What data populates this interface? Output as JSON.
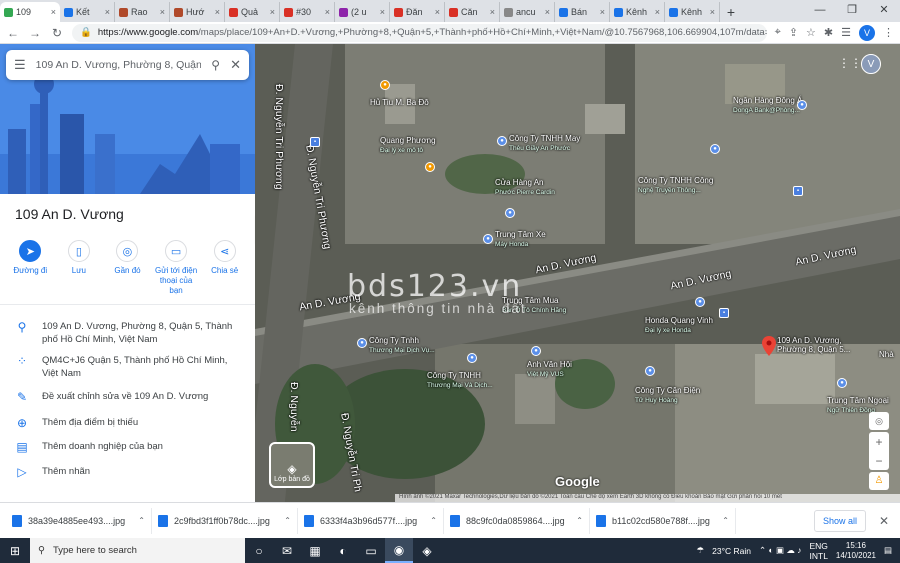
{
  "browser": {
    "tabs": [
      {
        "label": "109",
        "icon": "maps-pin-icon",
        "color": "#34a853",
        "active": true
      },
      {
        "label": "Kết",
        "icon": "image-icon",
        "color": "#1a73e8"
      },
      {
        "label": "Rao",
        "icon": "house-icon",
        "color": "#b0492a"
      },
      {
        "label": "Hướ",
        "icon": "house-icon",
        "color": "#b0492a"
      },
      {
        "label": "Quả",
        "icon": "grid-icon",
        "color": "#d93025"
      },
      {
        "label": "#30",
        "icon": "home-icon",
        "color": "#d93025"
      },
      {
        "label": "(2 u",
        "icon": "mail-icon",
        "color": "#8e24aa"
      },
      {
        "label": "Đăn",
        "icon": "house-icon",
        "color": "#d93025"
      },
      {
        "label": "Căn",
        "icon": "home-icon",
        "color": "#d93025"
      },
      {
        "label": "ancu",
        "icon": "house-icon",
        "color": "#888888"
      },
      {
        "label": "Bán",
        "icon": "house-icon",
        "color": "#1a73e8"
      },
      {
        "label": "Kênh",
        "icon": "house-icon",
        "color": "#1a73e8"
      },
      {
        "label": "Kênh",
        "icon": "house-icon",
        "color": "#1a73e8"
      }
    ],
    "new_tab": "+",
    "url_domain": "https://www.google.com",
    "url_rest": "/maps/place/109+An+D.+Vương,+Phường+8,+Quận+5,+Thành+phố+Hồ+Chí+Minh,+Việt+Nam/@10.7567968,106.669904,107m/data=!3m1!1e3!4m13!1...",
    "profile_letter": "V"
  },
  "panel": {
    "search_value": "109 An D. Vương, Phường 8, Quận",
    "place_title": "109 An D. Vương",
    "actions": [
      {
        "label": "Đường đi",
        "icon": "directions-icon"
      },
      {
        "label": "Lưu",
        "icon": "bookmark-icon"
      },
      {
        "label": "Gần đó",
        "icon": "nearby-icon"
      },
      {
        "label": "Gửi tới điện thoại của bạn",
        "icon": "send-to-phone-icon"
      },
      {
        "label": "Chia sẻ",
        "icon": "share-icon"
      }
    ],
    "info": [
      {
        "icon": "location-pin-icon",
        "text": "109 An D. Vương, Phường 8, Quận 5, Thành phố Hồ Chí Minh, Việt Nam"
      },
      {
        "icon": "plus-code-icon",
        "text": "QM4C+J6 Quận 5, Thành phố Hồ Chí Minh, Việt Nam"
      },
      {
        "icon": "pencil-icon",
        "text": "Đề xuất chỉnh sửa về 109 An D. Vương"
      },
      {
        "icon": "add-place-icon",
        "text": "Thêm địa điểm bị thiếu"
      },
      {
        "icon": "add-business-icon",
        "text": "Thêm doanh nghiệp của bạn"
      },
      {
        "icon": "label-icon",
        "text": "Thêm nhãn"
      }
    ]
  },
  "map": {
    "streets": [
      "An D. Vương",
      "An D. Vương",
      "An D. Vương",
      "An D. Vương",
      "Đ. Nguyễn Tri Phương",
      "Đ. Nguyễn Tri Phương",
      "Đ. Nguyễn",
      "Đ. Nguyễn Tri Ph"
    ],
    "pois": [
      {
        "name": "Hủ Tiu M. Ba Đô",
        "sub": ""
      },
      {
        "name": "Quang Phương",
        "sub": "Đại lý xe mô tô"
      },
      {
        "name": "Công Ty TNHH May",
        "sub": "Thêu Giầy An Phước"
      },
      {
        "name": "Ngân Hàng Đông Á",
        "sub": "DongA Bank@Phòng..."
      },
      {
        "name": "Cửa Hàng An",
        "sub": "Phước Pierre Cardin"
      },
      {
        "name": "Công Ty TNHH Công",
        "sub": "Nghệ Truyền Thông..."
      },
      {
        "name": "Trung Tâm Xe",
        "sub": "Máy Honda"
      },
      {
        "name": "Trung Tâm Mua",
        "sub": "Bán Ô Tô Chính Hãng"
      },
      {
        "name": "Honda Quang Vinh",
        "sub": "Đại lý xe Honda"
      },
      {
        "name": "Công Ty Tnhh",
        "sub": "Thương Mại Dịch Vụ..."
      },
      {
        "name": "Anh Văn Hội",
        "sub": "Việt Mỹ VUS"
      },
      {
        "name": "Công Ty TNHH",
        "sub": "Thương Mại Và Dịch..."
      },
      {
        "name": "Công Ty Cân Điện",
        "sub": "Tử Huy Hoàng"
      },
      {
        "name": "Trung Tâm Ngoại",
        "sub": "Ngữ Thiên Đồng"
      },
      {
        "name": "Nhà",
        "sub": ""
      }
    ],
    "selected_label": "109 An D. Vương, Phường 8, Quận 5...",
    "watermark": "bds123.vn",
    "watermark_sub": "kênh thông tin nhà đất",
    "layer_label": "Lớp bản đồ",
    "google": "Google",
    "attribution": "Hình ảnh ©2021 Maxar Technologies,Dữ liệu bản đồ ©2021   Toàn cầu   Chế độ xem Earth 3D không có   Điều khoản   Bảo mật   Gửi phản hồi   10 mét",
    "avatar_letter": "V"
  },
  "downloads": {
    "items": [
      "38a39e4885ee493....jpg",
      "2c9fbd3f1ff0b78dc....jpg",
      "6333f4a3b96d577f....jpg",
      "88c9fc0da0859864....jpg",
      "b11c02cd580e788f....jpg"
    ],
    "show_all": "Show all"
  },
  "taskbar": {
    "search_placeholder": "Type here to search",
    "weather": "23°C  Rain",
    "lang": "ENG",
    "lang2": "INTL",
    "time": "15:16",
    "date": "14/10/2021"
  }
}
